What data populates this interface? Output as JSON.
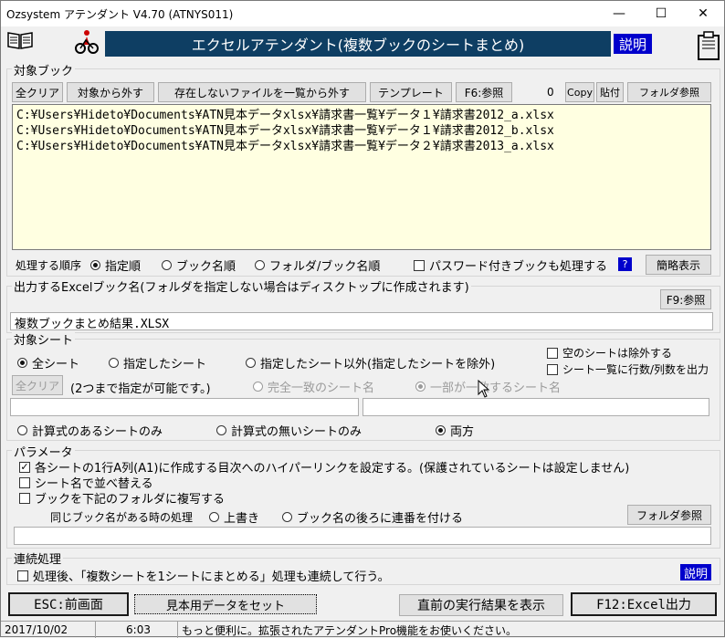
{
  "window": {
    "title": "Ozsystem アテンダント V4.70 (ATNYS011)",
    "min": "—",
    "max": "☐",
    "close": "✕"
  },
  "banner": {
    "title": "エクセルアテンダント(複数ブックのシートまとめ)",
    "help": "説明"
  },
  "books": {
    "label": "対象ブック",
    "buttons": {
      "clear_all": "全クリア",
      "remove": "対象から外す",
      "remove_missing": "存在しないファイルを一覧から外す",
      "template": "テンプレート",
      "f6_ref": "F6:参照",
      "copy": "Copy",
      "paste": "貼付",
      "folder_ref": "フォルダ参照"
    },
    "count": "0",
    "files": [
      "C:¥Users¥Hideto¥Documents¥ATN見本データxlsx¥請求書一覧¥データ１¥請求書2012_a.xlsx",
      "C:¥Users¥Hideto¥Documents¥ATN見本データxlsx¥請求書一覧¥データ１¥請求書2012_b.xlsx",
      "C:¥Users¥Hideto¥Documents¥ATN見本データxlsx¥請求書一覧¥データ２¥請求書2013_a.xlsx"
    ],
    "order_label": "処理する順序",
    "order": {
      "specified": "指定順",
      "book": "ブック名順",
      "folder": "フォルダ/ブック名順"
    },
    "password": "パスワード付きブックも処理する",
    "q": "?",
    "simple": "簡略表示"
  },
  "output": {
    "label": "出力するExcelブック名(フォルダを指定しない場合はディスクトップに作成されます)",
    "f9_ref": "F9:参照",
    "value": "複数ブックまとめ結果.XLSX"
  },
  "sheets": {
    "label": "対象シート",
    "all": "全シート",
    "specified": "指定したシート",
    "except": "指定したシート以外(指定したシートを除外)",
    "skip_empty": "空のシートは除外する",
    "rowcol": "シート一覧に行数/列数を出力",
    "clear": "全クリア",
    "note": "(2つまで指定が可能です。)",
    "exact": "完全一致のシート名",
    "partial": "一部が一致するシート名",
    "formula": "計算式のあるシートのみ",
    "noformula": "計算式の無いシートのみ",
    "both": "両方"
  },
  "params": {
    "label": "パラメータ",
    "hyperlink": "各シートの1行A列(A1)に作成する目次へのハイパーリンクを設定する。(保護されているシートは設定しません)",
    "sort": "シート名で並べ替える",
    "copy": "ブックを下記のフォルダに複写する",
    "same_label": "同じブック名がある時の処理",
    "overwrite": "上書き",
    "serial": "ブック名の後ろに連番を付ける",
    "folder_ref": "フォルダ参照"
  },
  "chain": {
    "label": "連続処理",
    "text": "処理後、「複数シートを1シートにまとめる」処理も連続して行う。",
    "help": "説明"
  },
  "footer": {
    "esc": "ESC:前画面",
    "sample": "見本用データをセット",
    "last": "直前の実行結果を表示",
    "f12": "F12:Excel出力"
  },
  "status": {
    "date": "2017/10/02",
    "time": "6:03",
    "msg": "もっと便利に。拡張されたアテンダントPro機能をお使いください。"
  },
  "colors": {
    "banner": "#0e3e63",
    "list": "#ffffe1",
    "help": "#0000cc"
  }
}
